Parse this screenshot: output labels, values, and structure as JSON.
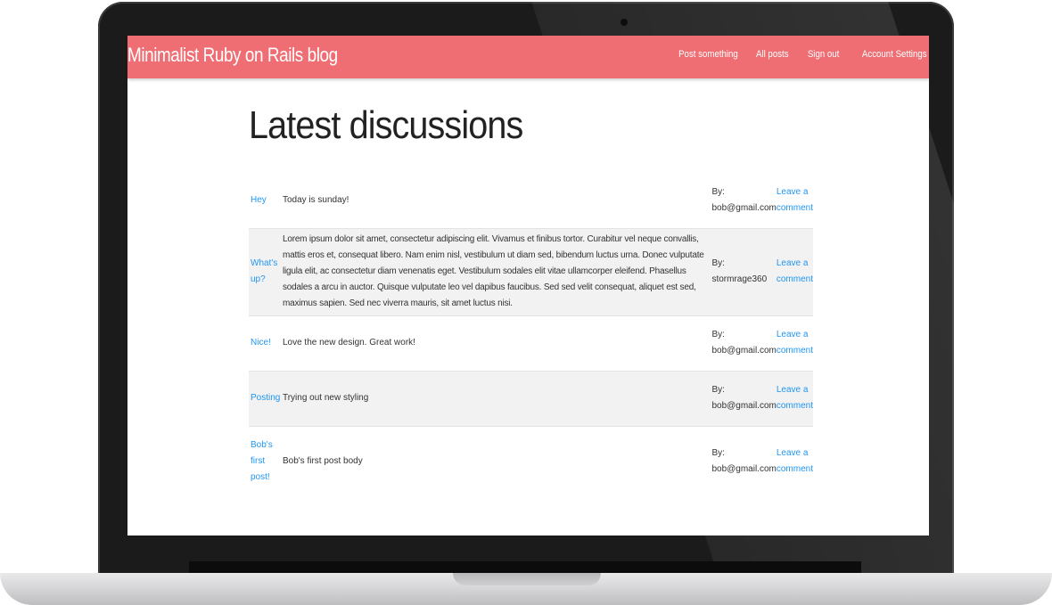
{
  "app": {
    "brand": "Minimalist Ruby on Rails blog",
    "nav": [
      {
        "label": "Post something"
      },
      {
        "label": "All posts"
      },
      {
        "label": "Sign out"
      },
      {
        "label": "Account Settings"
      }
    ]
  },
  "main": {
    "heading": "Latest discussions",
    "posts": [
      {
        "title": "Hey",
        "body": "Today is sunday!",
        "by_label": "By:",
        "author": "bob@gmail.com",
        "comment_link": "Leave a comment"
      },
      {
        "title": "What's up?",
        "body": "Lorem ipsum dolor sit amet, consectetur adipiscing elit. Vivamus et finibus tortor. Curabitur vel neque convallis, mattis eros et, consequat libero. Nam enim nisl, vestibulum ut diam sed, bibendum luctus urna. Donec vulputate ligula elit, ac consectetur diam venenatis eget. Vestibulum sodales elit vitae ullamcorper eleifend. Phasellus sodales a arcu in auctor. Quisque vulputate leo vel dapibus faucibus. Sed sed velit consequat, aliquet est sed, maximus sapien. Sed nec viverra mauris, sit amet luctus nisi.",
        "by_label": "By:",
        "author": "stormrage360",
        "comment_link": "Leave a comment"
      },
      {
        "title": "Nice!",
        "body": "Love the new design. Great work!",
        "by_label": "By:",
        "author": "bob@gmail.com",
        "comment_link": "Leave a comment"
      },
      {
        "title": "Posting",
        "body": "Trying out new styling",
        "by_label": "By:",
        "author": "bob@gmail.com",
        "comment_link": "Leave a comment"
      },
      {
        "title": "Bob's first post!",
        "body": "Bob's first post body",
        "by_label": "By:",
        "author": "bob@gmail.com",
        "comment_link": "Leave a comment"
      }
    ]
  },
  "colors": {
    "navbar": "#ee6e73",
    "link": "#2196f3",
    "stripe": "#f2f2f2"
  }
}
